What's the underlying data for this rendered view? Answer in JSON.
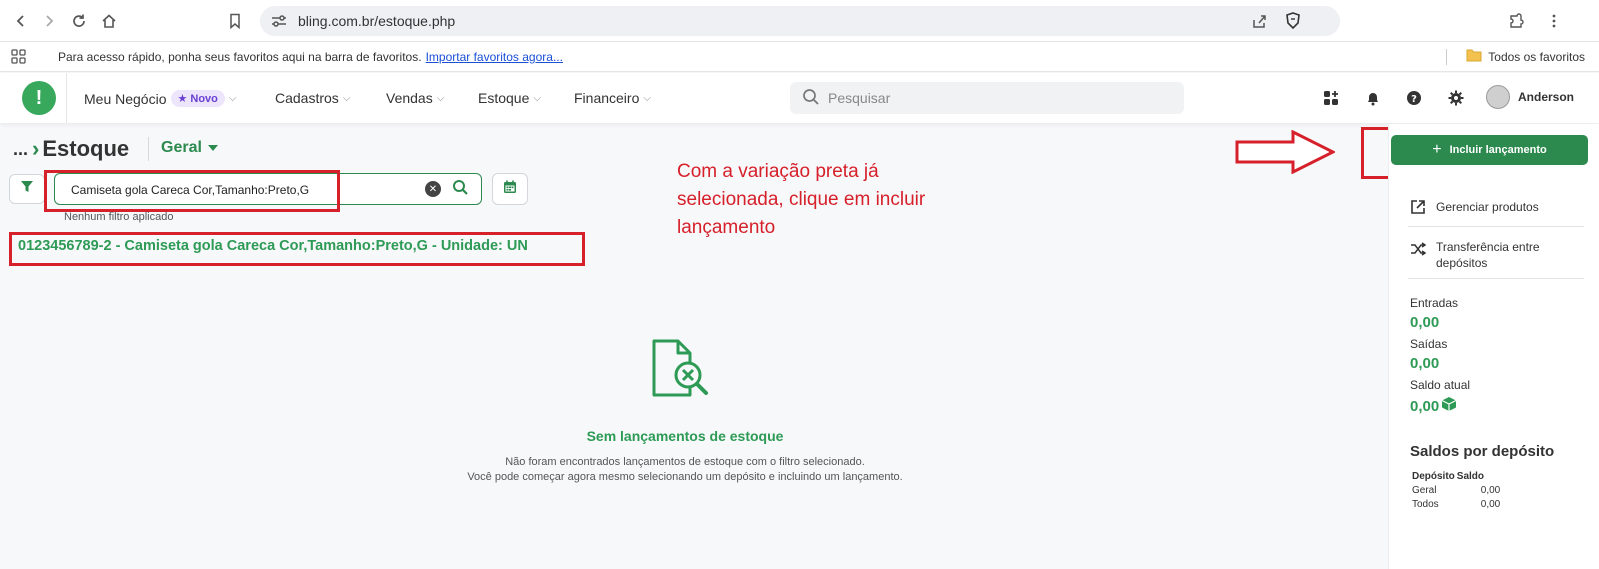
{
  "browser": {
    "url": "bling.com.br/estoque.php",
    "bookmarks_text": "Para acesso rápido, ponha seus favoritos aqui na barra de favoritos.",
    "bookmarks_link": "Importar favoritos agora...",
    "all_bookmarks": "Todos os favoritos"
  },
  "header": {
    "menu": [
      {
        "label": "Meu Negócio",
        "badge": "Novo"
      },
      {
        "label": "Cadastros"
      },
      {
        "label": "Vendas"
      },
      {
        "label": "Estoque"
      },
      {
        "label": "Financeiro"
      }
    ],
    "search_placeholder": "Pesquisar",
    "user_name": "Anderson"
  },
  "page": {
    "breadcrumb_prefix": "...",
    "title": "Estoque",
    "deposit": "Geral",
    "filter_value": "Camiseta gola Careca Cor,Tamanho:Preto,G",
    "filter_status": "Nenhum filtro aplicado",
    "product_line": "0123456789-2 - Camiseta gola Careca Cor,Tamanho:Preto,G - Unidade: UN",
    "instruction": "Com a variação preta já selecionada, clique em incluir lançamento",
    "empty_title": "Sem lançamentos de estoque",
    "empty_desc_1": "Não foram encontrados lançamentos de estoque com o filtro selecionado.",
    "empty_desc_2": "Você pode começar agora mesmo selecionando um depósito e incluindo um lançamento."
  },
  "sidebar": {
    "include_button": "Incluir lançamento",
    "manage_products": "Gerenciar produtos",
    "transfer": "Transferência entre depósitos",
    "entradas_label": "Entradas",
    "entradas_value": "0,00",
    "saidas_label": "Saídas",
    "saidas_value": "0,00",
    "saldo_label": "Saldo atual",
    "saldo_value": "0,00",
    "deposits_heading": "Saldos por depósito",
    "table_headers": [
      "Depósito",
      "Saldo"
    ],
    "table_rows": [
      {
        "deposito": "Geral",
        "saldo": "0,00"
      },
      {
        "deposito": "Todos",
        "saldo": "0,00"
      }
    ]
  },
  "colors": {
    "brand_green": "#2d8a4e",
    "annotation_red": "#d6202a"
  },
  "icons": [
    "back-icon",
    "forward-icon",
    "reload-icon",
    "home-icon",
    "bookmark-icon",
    "site-settings-icon",
    "share-icon",
    "brave-shield-icon",
    "extensions-icon",
    "apps-grid-icon",
    "folder-icon",
    "search-icon",
    "widgets-icon",
    "bell-icon",
    "help-icon",
    "gear-icon",
    "filter-icon",
    "clear-icon",
    "calendar-icon",
    "plus-icon",
    "external-link-icon",
    "shuffle-icon",
    "box-icon",
    "document-search-icon"
  ]
}
